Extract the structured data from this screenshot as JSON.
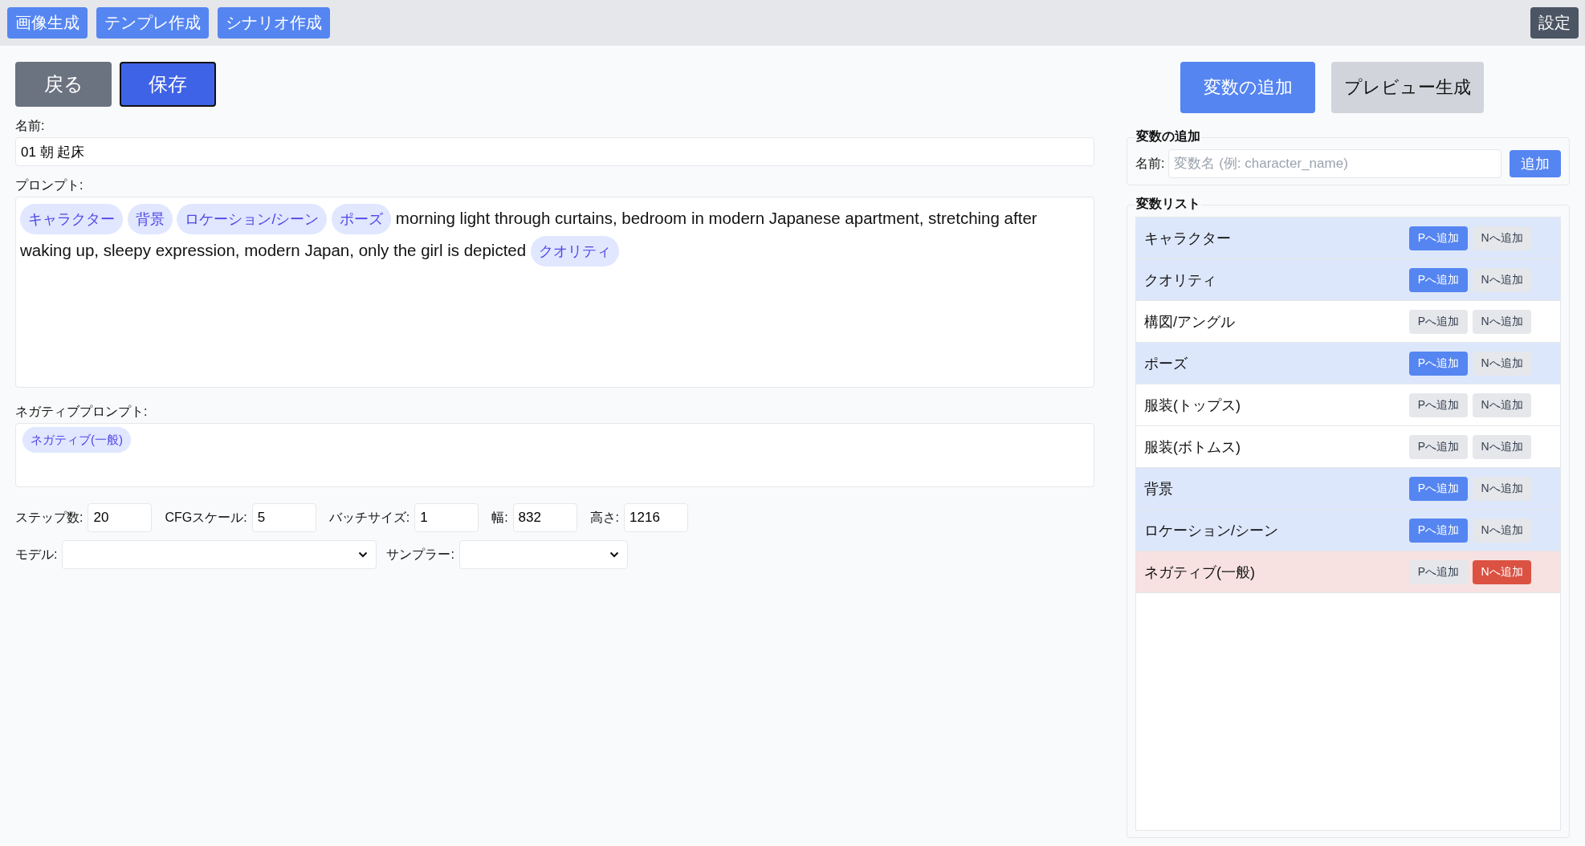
{
  "nav": {
    "items": [
      {
        "label": "画像生成"
      },
      {
        "label": "テンプレ作成"
      },
      {
        "label": "シナリオ作成"
      }
    ],
    "settings": "設定"
  },
  "actions": {
    "back": "戻る",
    "save": "保存"
  },
  "name": {
    "label": "名前:",
    "value": "01 朝 起床"
  },
  "prompt": {
    "label": "プロンプト:",
    "parts": [
      {
        "kind": "tag",
        "text": "キャラクター"
      },
      {
        "kind": "tag",
        "text": "背景"
      },
      {
        "kind": "tag",
        "text": "ロケーション/シーン"
      },
      {
        "kind": "tag",
        "text": "ポーズ"
      },
      {
        "kind": "text",
        "text": "morning light through curtains, bedroom in modern Japanese apartment, stretching after"
      },
      {
        "kind": "text",
        "text": "waking up, sleepy expression, modern Japan, only the girl is depicted"
      },
      {
        "kind": "tag",
        "text": "クオリティ"
      }
    ]
  },
  "negative_prompt": {
    "label": "ネガティブプロンプト:",
    "parts": [
      {
        "kind": "tag",
        "text": "ネガティブ(一般)"
      }
    ]
  },
  "params": [
    {
      "label": "ステップ数:",
      "value": "20"
    },
    {
      "label": "CFGスケール:",
      "value": "5"
    },
    {
      "label": "バッチサイズ:",
      "value": "1"
    },
    {
      "label": "幅:",
      "value": "832"
    },
    {
      "label": "高さ:",
      "value": "1216"
    }
  ],
  "selects": [
    {
      "label": "モデル:",
      "kind": "wide"
    },
    {
      "label": "サンプラー:",
      "kind": "narrow"
    }
  ],
  "right_actions": [
    {
      "label": "変数の追加",
      "kind": "primary"
    },
    {
      "label": "プレビュー生成",
      "kind": "secondary"
    }
  ],
  "add_variable": {
    "title": "変数の追加",
    "label": "名前:",
    "placeholder": "変数名 (例: character_name)",
    "button": "追加"
  },
  "variable_list": {
    "title": "変数リスト",
    "items": [
      {
        "name": "キャラクター",
        "p_button": "Pへ追加",
        "n_button": "Nへ追加",
        "p_added": true,
        "n_added": false
      },
      {
        "name": "クオリティ",
        "p_button": "Pへ追加",
        "n_button": "Nへ追加",
        "p_added": true,
        "n_added": false
      },
      {
        "name": "構図/アングル",
        "p_button": "Pへ追加",
        "n_button": "Nへ追加",
        "p_added": false,
        "n_added": false
      },
      {
        "name": "ポーズ",
        "p_button": "Pへ追加",
        "n_button": "Nへ追加",
        "p_added": true,
        "n_added": false
      },
      {
        "name": "服装(トップス)",
        "p_button": "Pへ追加",
        "n_button": "Nへ追加",
        "p_added": false,
        "n_added": false
      },
      {
        "name": "服装(ボトムス)",
        "p_button": "Pへ追加",
        "n_button": "Nへ追加",
        "p_added": false,
        "n_added": false
      },
      {
        "name": "背景",
        "p_button": "Pへ追加",
        "n_button": "Nへ追加",
        "p_added": true,
        "n_added": false
      },
      {
        "name": "ロケーション/シーン",
        "p_button": "Pへ追加",
        "n_button": "Nへ追加",
        "p_added": true,
        "n_added": false
      },
      {
        "name": "ネガティブ(一般)",
        "p_button": "Pへ追加",
        "n_button": "Nへ追加",
        "p_added": false,
        "n_added": true
      }
    ]
  }
}
